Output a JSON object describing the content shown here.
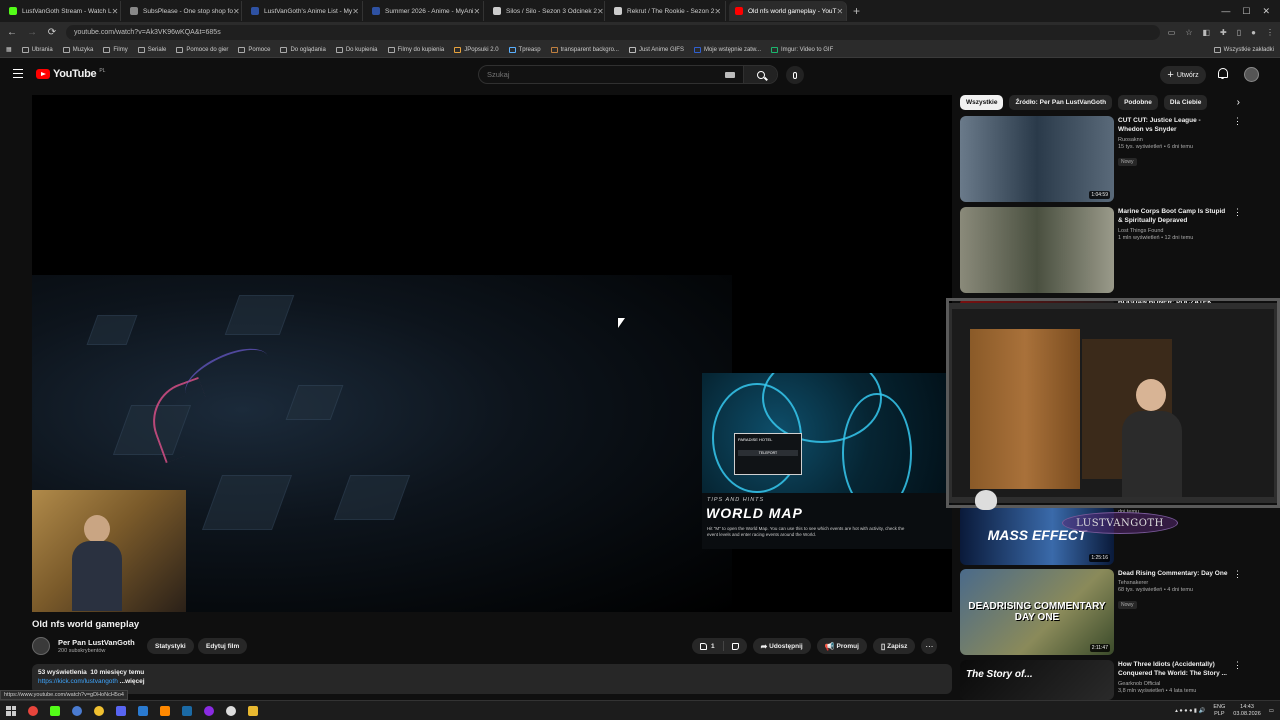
{
  "browser": {
    "tabs": [
      {
        "title": "LustVanGoth Stream - Watch L",
        "color": "#53fc18"
      },
      {
        "title": "SubsPlease - One stop shop fo",
        "color": "#888888"
      },
      {
        "title": "LustVanGoth's Anime List - My",
        "color": "#2e51a2"
      },
      {
        "title": "Summer 2026 - Anime - MyAni",
        "color": "#2e51a2"
      },
      {
        "title": "Silos / Silo - Sezon 3 Odcinek 2",
        "color": "#cccccc"
      },
      {
        "title": "Rekrut / The Rookie - Sezon 2",
        "color": "#cccccc"
      },
      {
        "title": "Old nfs world gameplay - YouT",
        "color": "#ff0000",
        "active": true
      }
    ],
    "url": "youtube.com/watch?v=Ak3VK96wKQA&t=685s",
    "bookmarks": [
      "Ubrania",
      "Muzyka",
      "Filmy",
      "Seriale",
      "Pomoce do gier",
      "Pomoce",
      "Do oglądania",
      "Do kupienia",
      "Filmy do kupienia",
      "JPopsuki 2.0",
      "Tpreasp",
      "transparent backgro...",
      "Just Anime GIFS",
      "Moje wstępnie zatw...",
      "Imgur: Video to GIF"
    ],
    "bookmarks_all": "Wszystkie zakładki"
  },
  "youtube": {
    "logo_text": "YouTube",
    "region": "PL",
    "search_placeholder": "Szukaj",
    "create_label": "Utwórz"
  },
  "video": {
    "tips_label": "TIPS AND HINTS",
    "tips_title": "WORLD MAP",
    "tips_body": "Hit \"M\" to open the World Map. You can use this to see which events are hot with activity, check the event levels and enter racing events around the World.",
    "map_popup": "PARADISE HOTEL",
    "map_button": "TELEPORT",
    "title": "Old nfs world gameplay",
    "channel_name": "Per Pan LustVanGoth",
    "subscribers": "200 subskrybentów",
    "stats_label": "Statystyki",
    "edit_label": "Edytuj film",
    "likes": "1",
    "share_label": "Udostępnij",
    "promote_label": "Promuj",
    "save_label": "Zapisz",
    "views": "53 wyświetlenia",
    "age": "10 miesięcy temu",
    "desc_link": "https://kick.com/lustvangoth",
    "desc_more": "...więcej",
    "status_url": "https://www.youtube.com/watch?v=gDHoNcH5o4"
  },
  "sidebar": {
    "chips": [
      "Wszystkie",
      "Źródło: Per Pan LustVanGoth",
      "Podobne",
      "Dla Ciebie"
    ],
    "recs": [
      {
        "title": "CUT CUT: Justice League - Whedon vs Snyder",
        "channel": "Ruosaknn",
        "meta": "15 tys. wyświetleń • 6 dni temu",
        "badge": "Nowy",
        "duration": "1:04:59",
        "thumb": "linear-gradient(90deg,#6a7a8a,#2a3a4a 50%,#5a6a7a)"
      },
      {
        "title": "Marine Corps Boot Camp Is Stupid & Spiritually Depraved",
        "channel": "Lost Things Found",
        "meta": "1 mln wyświetleń • 12 dni temu",
        "badge": "",
        "duration": "",
        "thumb": "linear-gradient(90deg,#8a8a7a,#4a5040 50%,#9a9a8a)"
      },
      {
        "title": "BOGDAN BONER: POCZĄTEK LEGENDY | Egzorcysta - Cały ...",
        "channel": "",
        "meta": "",
        "badge": "",
        "duration": "",
        "thumb": "linear-gradient(90deg,#7a1010,#1a1a1a)"
      },
      {
        "title": "",
        "channel": "",
        "meta": "dni temu",
        "badge": "",
        "duration": "1:25:16",
        "thumb": "linear-gradient(90deg,#0a1a3a,#3a6aaa 60%,#0a1a3a)",
        "thumb_text": "MASS EFFECT"
      },
      {
        "title": "Dead Rising Commentary: Day One",
        "channel": "Tehsnakerer",
        "meta": "68 tys. wyświetleń • 4 dni temu",
        "badge": "Nowy",
        "duration": "2:11:47",
        "thumb": "linear-gradient(135deg,#4a6a8a,#8a8a5a 60%,#3a4a2a)",
        "thumb_text": "DEADRISING COMMENTARY DAY ONE"
      },
      {
        "title": "How Three Idiots (Accidentally) Conquered The World: The Story ...",
        "channel": "Gearknob Official",
        "meta": "3,8 mln wyświetleń • 4 lata temu",
        "badge": "",
        "duration": "",
        "thumb": "linear-gradient(135deg,#0a0a0a,#2a2a2a)",
        "thumb_text": "The Story of..."
      }
    ]
  },
  "overlay": {
    "stream_name": "LUSTVANGOTH"
  },
  "taskbar": {
    "lang": "ENG",
    "lang2": "PLP",
    "time": "14:43",
    "date": "03.08.2026"
  }
}
